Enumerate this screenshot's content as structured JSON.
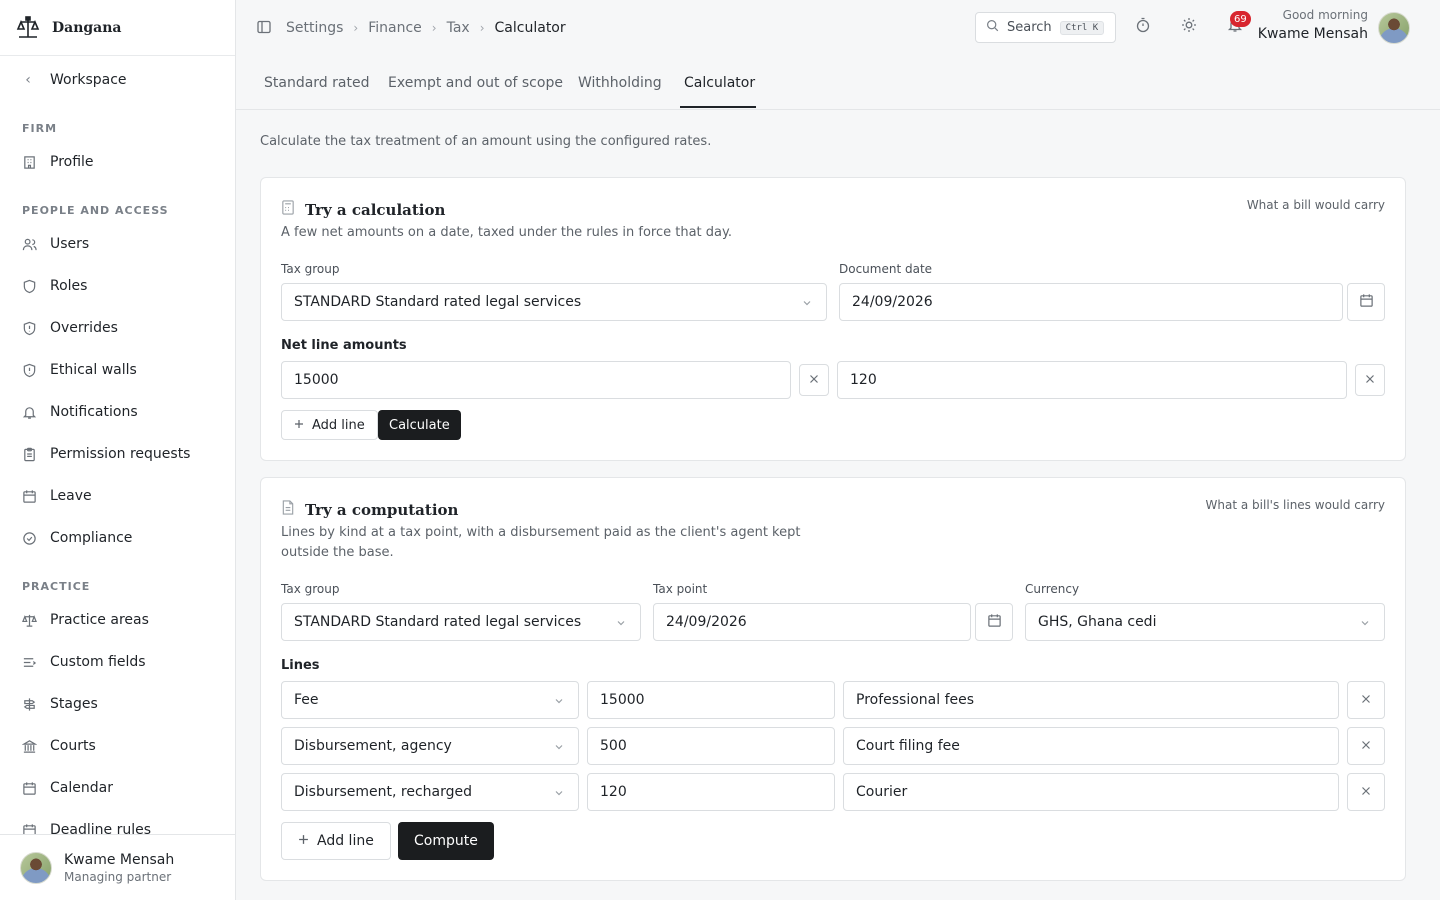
{
  "brand": {
    "name": "Dangana"
  },
  "sidebar": {
    "back_label": "Workspace",
    "sections": [
      {
        "label": "FIRM"
      },
      {
        "label": "PEOPLE AND ACCESS"
      },
      {
        "label": "PRACTICE"
      }
    ],
    "items": [
      {
        "label": "Profile",
        "icon": "building-icon"
      },
      {
        "label": "Users",
        "icon": "users-icon"
      },
      {
        "label": "Roles",
        "icon": "shield-icon"
      },
      {
        "label": "Overrides",
        "icon": "shield-icon"
      },
      {
        "label": "Ethical walls",
        "icon": "shield-icon"
      },
      {
        "label": "Notifications",
        "icon": "bell-icon"
      },
      {
        "label": "Permission requests",
        "icon": "clipboard-icon"
      },
      {
        "label": "Leave",
        "icon": "calendar-icon"
      },
      {
        "label": "Compliance",
        "icon": "check-circle-icon"
      },
      {
        "label": "Practice areas",
        "icon": "scale-icon"
      },
      {
        "label": "Custom fields",
        "icon": "list-icon"
      },
      {
        "label": "Stages",
        "icon": "signpost-icon"
      },
      {
        "label": "Courts",
        "icon": "landmark-icon"
      },
      {
        "label": "Calendar",
        "icon": "calendar-icon"
      },
      {
        "label": "Deadline rules",
        "icon": "calendar-clock-icon"
      }
    ],
    "footer": {
      "name": "Kwame Mensah",
      "role": "Managing partner"
    }
  },
  "header": {
    "breadcrumb": [
      "Settings",
      "Finance",
      "Tax",
      "Calculator"
    ],
    "search_label": "Search",
    "search_shortcut": "Ctrl K",
    "notifications_count": "69",
    "greeting": "Good morning",
    "user_name": "Kwame Mensah"
  },
  "tabs": [
    {
      "label": "Standard rated"
    },
    {
      "label": "Exempt and out of scope"
    },
    {
      "label": "Withholding"
    },
    {
      "label": "Calculator"
    }
  ],
  "intro": "Calculate the tax treatment of an amount using the configured rates.",
  "calculation": {
    "title": "Try a calculation",
    "subtitle": "A few net amounts on a date, taxed under the rules in force that day.",
    "right_note": "What a bill would carry",
    "tax_group_label": "Tax group",
    "tax_group_value": "STANDARD Standard rated legal services",
    "document_date_label": "Document date",
    "document_date_value": "24/09/2026",
    "net_amounts_label": "Net line amounts",
    "amounts": [
      "15000",
      "120"
    ],
    "add_line_label": "Add line",
    "calculate_label": "Calculate"
  },
  "computation": {
    "title": "Try a computation",
    "subtitle": "Lines by kind at a tax point, with a disbursement paid as the client's agent kept outside the base.",
    "right_note": "What a bill's lines would carry",
    "tax_group_label": "Tax group",
    "tax_group_value": "STANDARD Standard rated legal services",
    "tax_point_label": "Tax point",
    "tax_point_value": "24/09/2026",
    "currency_label": "Currency",
    "currency_value": "GHS, Ghana cedi",
    "lines_label": "Lines",
    "lines": [
      {
        "kind": "Fee",
        "amount": "15000",
        "description": "Professional fees"
      },
      {
        "kind": "Disbursement, agency",
        "amount": "500",
        "description": "Court filing fee"
      },
      {
        "kind": "Disbursement, recharged",
        "amount": "120",
        "description": "Courier"
      }
    ],
    "add_line_label": "Add line",
    "compute_label": "Compute"
  }
}
